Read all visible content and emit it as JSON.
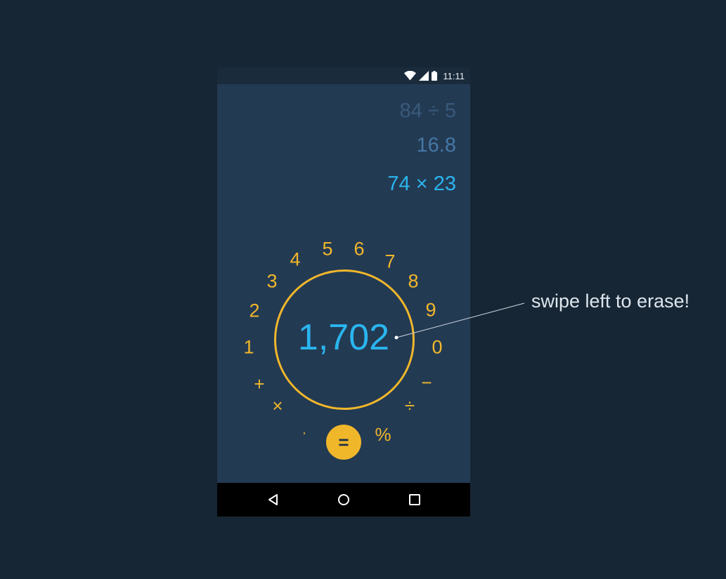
{
  "status_bar": {
    "time": "11:11",
    "icons": [
      "wifi-icon",
      "signal-icon",
      "battery-icon"
    ]
  },
  "history": [
    {
      "expression": "84 ÷ 5",
      "color": "#385a7b"
    },
    {
      "expression": "16.8",
      "color": "#4577a6"
    },
    {
      "expression": "74 × 23",
      "color": "#2ab5ee"
    }
  ],
  "display": {
    "value": "1,702"
  },
  "dial": {
    "digits": [
      "1",
      "2",
      "3",
      "4",
      "5",
      "6",
      "7",
      "8",
      "9",
      "0"
    ],
    "operators": {
      "plus": "+",
      "minus": "−",
      "multiply": "×",
      "divide": "÷",
      "decimal": "·",
      "percent": "%",
      "equals": "="
    }
  },
  "annotation": {
    "text": "swipe left to erase!"
  },
  "nav": {
    "icons": [
      "back-icon",
      "home-icon",
      "recent-apps-icon"
    ]
  },
  "colors": {
    "background": "#172634",
    "screen": "#233a53",
    "accent": "#f1b72b",
    "display": "#2ab5ee"
  }
}
